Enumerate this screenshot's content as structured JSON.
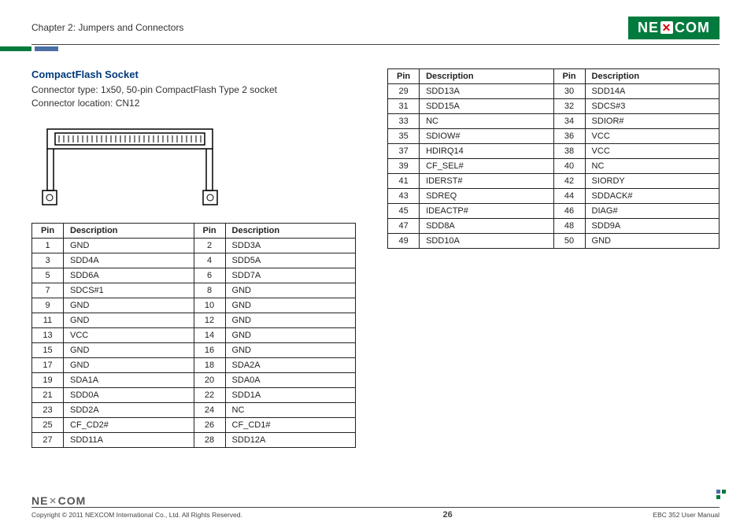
{
  "header": {
    "chapter": "Chapter 2: Jumpers and Connectors",
    "logo_pre": "NE",
    "logo_x": "✕",
    "logo_post": "COM"
  },
  "section": {
    "title": "CompactFlash Socket",
    "line1": "Connector type: 1x50, 50-pin CompactFlash Type 2 socket",
    "line2": "Connector location: CN12"
  },
  "table_headers": {
    "pin": "Pin",
    "desc": "Description"
  },
  "pins_left": [
    {
      "p1": "1",
      "d1": "GND",
      "p2": "2",
      "d2": "SDD3A"
    },
    {
      "p1": "3",
      "d1": "SDD4A",
      "p2": "4",
      "d2": "SDD5A"
    },
    {
      "p1": "5",
      "d1": "SDD6A",
      "p2": "6",
      "d2": "SDD7A"
    },
    {
      "p1": "7",
      "d1": "SDCS#1",
      "p2": "8",
      "d2": "GND"
    },
    {
      "p1": "9",
      "d1": "GND",
      "p2": "10",
      "d2": "GND"
    },
    {
      "p1": "11",
      "d1": "GND",
      "p2": "12",
      "d2": "GND"
    },
    {
      "p1": "13",
      "d1": "VCC",
      "p2": "14",
      "d2": "GND"
    },
    {
      "p1": "15",
      "d1": "GND",
      "p2": "16",
      "d2": "GND"
    },
    {
      "p1": "17",
      "d1": "GND",
      "p2": "18",
      "d2": "SDA2A"
    },
    {
      "p1": "19",
      "d1": "SDA1A",
      "p2": "20",
      "d2": "SDA0A"
    },
    {
      "p1": "21",
      "d1": "SDD0A",
      "p2": "22",
      "d2": "SDD1A"
    },
    {
      "p1": "23",
      "d1": "SDD2A",
      "p2": "24",
      "d2": "NC"
    },
    {
      "p1": "25",
      "d1": "CF_CD2#",
      "p2": "26",
      "d2": "CF_CD1#"
    },
    {
      "p1": "27",
      "d1": "SDD11A",
      "p2": "28",
      "d2": "SDD12A"
    }
  ],
  "pins_right": [
    {
      "p1": "29",
      "d1": "SDD13A",
      "p2": "30",
      "d2": "SDD14A"
    },
    {
      "p1": "31",
      "d1": "SDD15A",
      "p2": "32",
      "d2": "SDCS#3"
    },
    {
      "p1": "33",
      "d1": "NC",
      "p2": "34",
      "d2": "SDIOR#"
    },
    {
      "p1": "35",
      "d1": "SDIOW#",
      "p2": "36",
      "d2": "VCC"
    },
    {
      "p1": "37",
      "d1": "HDIRQ14",
      "p2": "38",
      "d2": "VCC"
    },
    {
      "p1": "39",
      "d1": "CF_SEL#",
      "p2": "40",
      "d2": "NC"
    },
    {
      "p1": "41",
      "d1": "IDERST#",
      "p2": "42",
      "d2": "SIORDY"
    },
    {
      "p1": "43",
      "d1": "SDREQ",
      "p2": "44",
      "d2": "SDDACK#"
    },
    {
      "p1": "45",
      "d1": "IDEACTP#",
      "p2": "46",
      "d2": "DIAG#"
    },
    {
      "p1": "47",
      "d1": "SDD8A",
      "p2": "48",
      "d2": "SDD9A"
    },
    {
      "p1": "49",
      "d1": "SDD10A",
      "p2": "50",
      "d2": "GND"
    }
  ],
  "footer": {
    "logo_pre": "NE",
    "logo_x": "✕",
    "logo_post": "COM",
    "copyright": "Copyright © 2011 NEXCOM International Co., Ltd. All Rights Reserved.",
    "page": "26",
    "manual": "EBC 352 User Manual"
  }
}
